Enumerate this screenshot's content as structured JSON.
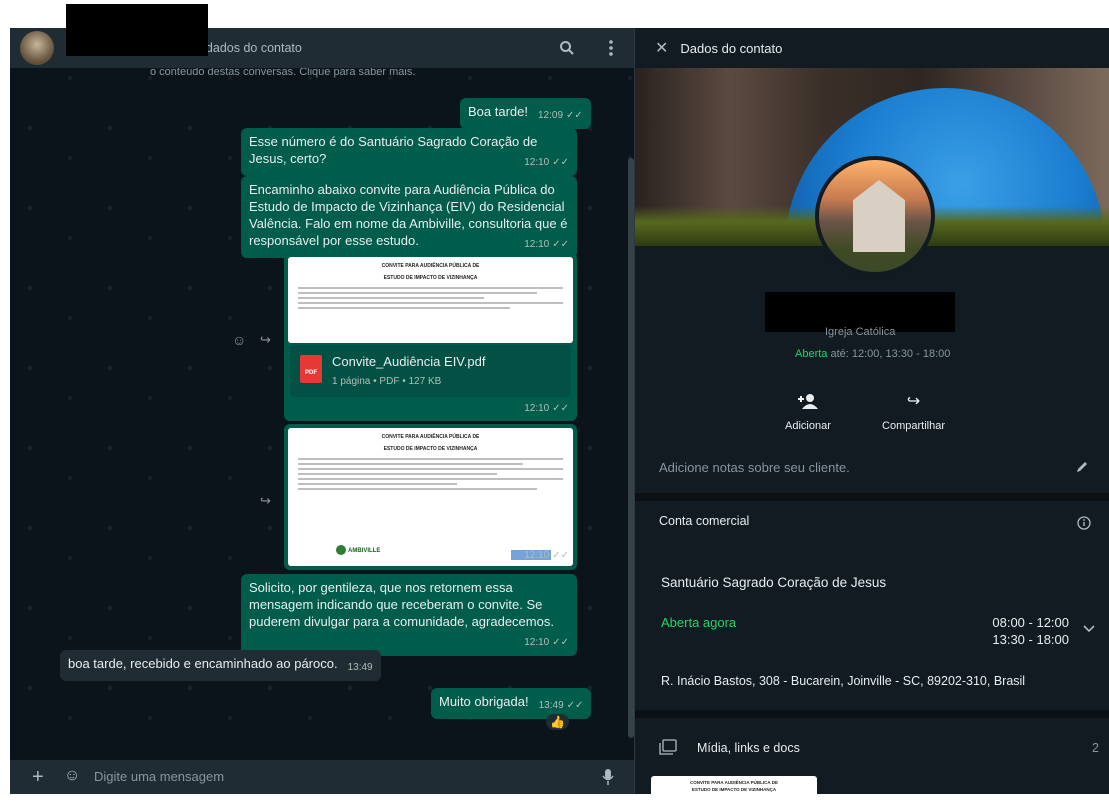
{
  "chat": {
    "header_text": "Clique para mostrar os dados do contato",
    "system_line": "o conteúdo destas conversas. Clique para saber mais.",
    "messages": [
      {
        "text": "Boa tarde!",
        "time": "12:09"
      },
      {
        "text": "Esse número é do Santuário Sagrado Coração de Jesus, certo?",
        "time": "12:10"
      },
      {
        "text": "Encaminho abaixo convite para Audiência Pública do Estudo de Impacto de Vizinhança (EIV) do Residencial Valência. Falo em nome da Ambiville, consultoria que é responsável por esse estudo.",
        "time": "12:10"
      },
      {
        "doc_name": "Convite_Audiência EIV.pdf",
        "doc_meta": "1 página • PDF • 127 KB",
        "doc_badge": "PDF",
        "doc_title_1": "CONVITE PARA AUDIÊNCIA PÚBLICA DE",
        "doc_title_2": "ESTUDO DE IMPACTO DE VIZINHANÇA",
        "time": "12:10"
      },
      {
        "image_title_1": "CONVITE PARA AUDIÊNCIA PÚBLICA DE",
        "image_title_2": "ESTUDO DE IMPACTO DE VIZINHANÇA",
        "logo_text": "AMBIVILLE",
        "time": "12:10"
      },
      {
        "text": "Solicito, por gentileza, que nos retornem essa mensagem indicando que receberam o convite. Se puderem divulgar para a comunidade, agradecemos.",
        "time": "12:10"
      },
      {
        "text": "boa tarde, recebido e encaminhado ao pároco.",
        "time": "13:49"
      },
      {
        "text": "Muito obrigada!",
        "time": "13:49",
        "reaction": "👍"
      }
    ],
    "compose_placeholder": "Digite uma mensagem"
  },
  "panel": {
    "title": "Dados do contato",
    "category": "Igreja Católica",
    "open_label": "Aberta",
    "hours_summary": "até: 12:00, 13:30 - 18:00",
    "actions": [
      {
        "label": "Adicionar"
      },
      {
        "label": "Compartilhar"
      }
    ],
    "notes_placeholder": "Adicione notas sobre seu cliente.",
    "business_account": "Conta comercial",
    "business_name": "Santuário Sagrado Coração de Jesus",
    "open_now": "Aberta agora",
    "schedule": [
      "08:00 - 12:00",
      "13:30 - 18:00"
    ],
    "address": "R. Inácio Bastos, 308 - Bucarein, Joinville - SC, 89202-310, Brasil",
    "media_label": "Mídia, links e docs",
    "media_count": "2",
    "media_thumb_title_1": "CONVITE PARA AUDIÊNCIA PÚBLICA DE",
    "media_thumb_title_2": "ESTUDO DE IMPACTO DE VIZINHANÇA"
  },
  "colors": {
    "outgoing": "#005c4b",
    "incoming": "#202c33",
    "accent_green": "#25d366",
    "panel_bg": "#111b21"
  }
}
